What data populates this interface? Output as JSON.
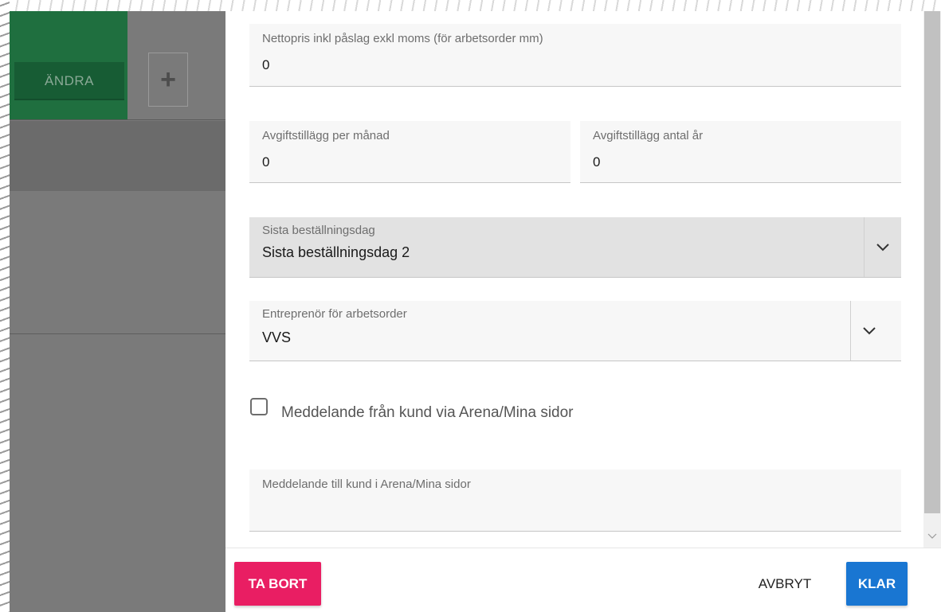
{
  "background": {
    "edit_button_label": "ÄNDRA",
    "add_button_icon": "plus-icon"
  },
  "form": {
    "net_price": {
      "label": "Nettopris inkl påslag exkl moms (för arbetsorder mm)",
      "value": "0"
    },
    "fee_per_month": {
      "label": "Avgiftstillägg per månad",
      "value": "0"
    },
    "fee_years": {
      "label": "Avgiftstillägg antal år",
      "value": "0"
    },
    "last_order_day": {
      "label": "Sista beställningsdag",
      "value": "Sista beställningsdag 2",
      "icon": "chevron-down-icon"
    },
    "contractor": {
      "label": "Entreprenör för arbetsorder",
      "value": "VVS",
      "icon": "chevron-down-icon"
    },
    "message_from_customer": {
      "label": "Meddelande från kund via Arena/Mina sidor",
      "checked": false
    },
    "message_to_customer": {
      "label": "Meddelande till kund i Arena/Mina sidor",
      "value": ""
    }
  },
  "footer": {
    "delete_label": "TA BORT",
    "cancel_label": "AVBRYT",
    "ok_label": "KLAR"
  },
  "colors": {
    "green_tile": "#1f6f3f",
    "delete_button": "#e91e63",
    "ok_button": "#1976d2",
    "field_background": "#f7f7f7",
    "select_highlight": "#e2e2e2"
  }
}
